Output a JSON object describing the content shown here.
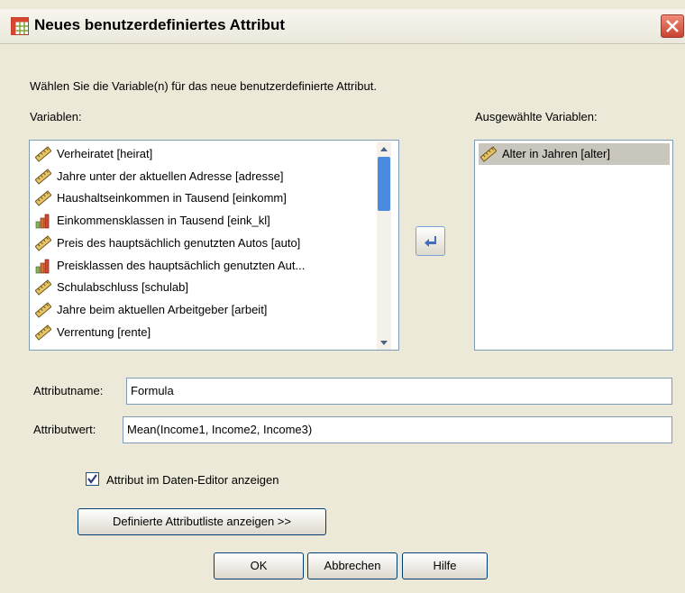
{
  "window": {
    "title": "Neues benutzerdefiniertes Attribut",
    "icon": "data-grid-icon"
  },
  "instruction": "Wählen Sie die Variable(n) für das neue benutzerdefinierte Attribut.",
  "variables_label": "Variablen:",
  "selected_label": "Ausgewählte Variablen:",
  "variables": [
    {
      "label": "Verheiratet [heirat]",
      "icon": "ruler-icon"
    },
    {
      "label": "Jahre unter der aktuellen Adresse [adresse]",
      "icon": "ruler-icon"
    },
    {
      "label": "Haushaltseinkommen in Tausend [einkomm]",
      "icon": "ruler-icon"
    },
    {
      "label": "Einkommensklassen in Tausend [eink_kl]",
      "icon": "bar-chart-icon"
    },
    {
      "label": "Preis des hauptsächlich genutzten Autos [auto]",
      "icon": "ruler-icon"
    },
    {
      "label": "Preisklassen des hauptsächlich genutzten Aut...",
      "icon": "bar-chart-icon"
    },
    {
      "label": "Schulabschluss [schulab]",
      "icon": "ruler-icon"
    },
    {
      "label": "Jahre beim aktuellen Arbeitgeber [arbeit]",
      "icon": "ruler-icon"
    },
    {
      "label": "Verrentung [rente]",
      "icon": "ruler-icon"
    }
  ],
  "selected_variables": [
    {
      "label": "Alter in Jahren [alter]",
      "icon": "ruler-icon"
    }
  ],
  "attribute_name_label": "Attributname:",
  "attribute_name_value": "Formula",
  "attribute_value_label": "Attributwert:",
  "attribute_value_value": "Mean(Income1, Income2, Income3)",
  "show_in_editor": {
    "label": "Attribut im Daten-Editor anzeigen",
    "checked": true
  },
  "show_list_button": "Definierte Attributliste anzeigen >>",
  "buttons": {
    "ok": "OK",
    "cancel": "Abbrechen",
    "help": "Hilfe"
  },
  "colors": {
    "accent": "#4a8be0",
    "selection": "#c9c6bd",
    "close": "#c7432e"
  }
}
